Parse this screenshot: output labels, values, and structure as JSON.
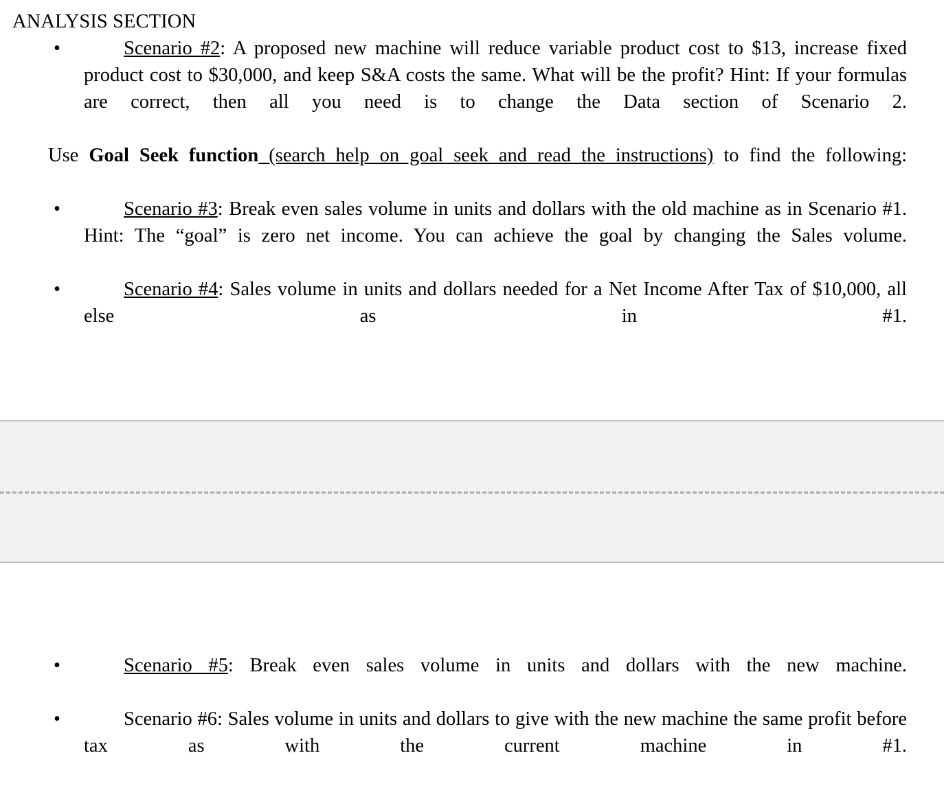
{
  "document": {
    "heading": "ANALYSIS SECTION",
    "bullet_glyph": "•",
    "upper_blocks": {
      "scenario2": {
        "label": "Scenario #2",
        "label_suffix": ":",
        "text": "  A proposed new machine will reduce variable product cost to $13, increase fixed product cost to $30,000, and keep S&A costs the same.  What will be the profit?  Hint:  If your formulas are correct, then all you need is to change the Data section of Scenario 2."
      },
      "goal_seek_intro": {
        "prefix": "Use ",
        "bold_text": "Goal Seek function",
        "underlined_text": " (search help on goal seek and read the instructions)",
        "suffix": " to find the following:"
      },
      "scenario3": {
        "label": "Scenario #3",
        "label_suffix": ":",
        "text": "  Break even sales volume in units and dollars with the old machine as in Scenario #1.  Hint:  The “goal” is zero net income.  You can achieve the goal by changing the Sales volume."
      },
      "scenario4": {
        "label": "Scenario #4",
        "label_suffix": ":",
        "text": "  Sales volume in units and dollars needed for a Net Income After Tax of $10,000, all else as in #1."
      }
    },
    "lower_blocks": {
      "scenario5": {
        "label": "Scenario #5",
        "label_suffix": ":",
        "text": "  Break even sales volume in units and dollars with the new machine."
      },
      "scenario6": {
        "label": "Scenario #6",
        "label_suffix": ":",
        "text": "  Sales volume in units and dollars to give with the new machine the same profit before tax as with the current machine in #1."
      }
    }
  },
  "panel": {
    "fill_color": "#f1f1f1",
    "border_color": "#bfc3c9",
    "divider_color": "#a8acb2"
  }
}
